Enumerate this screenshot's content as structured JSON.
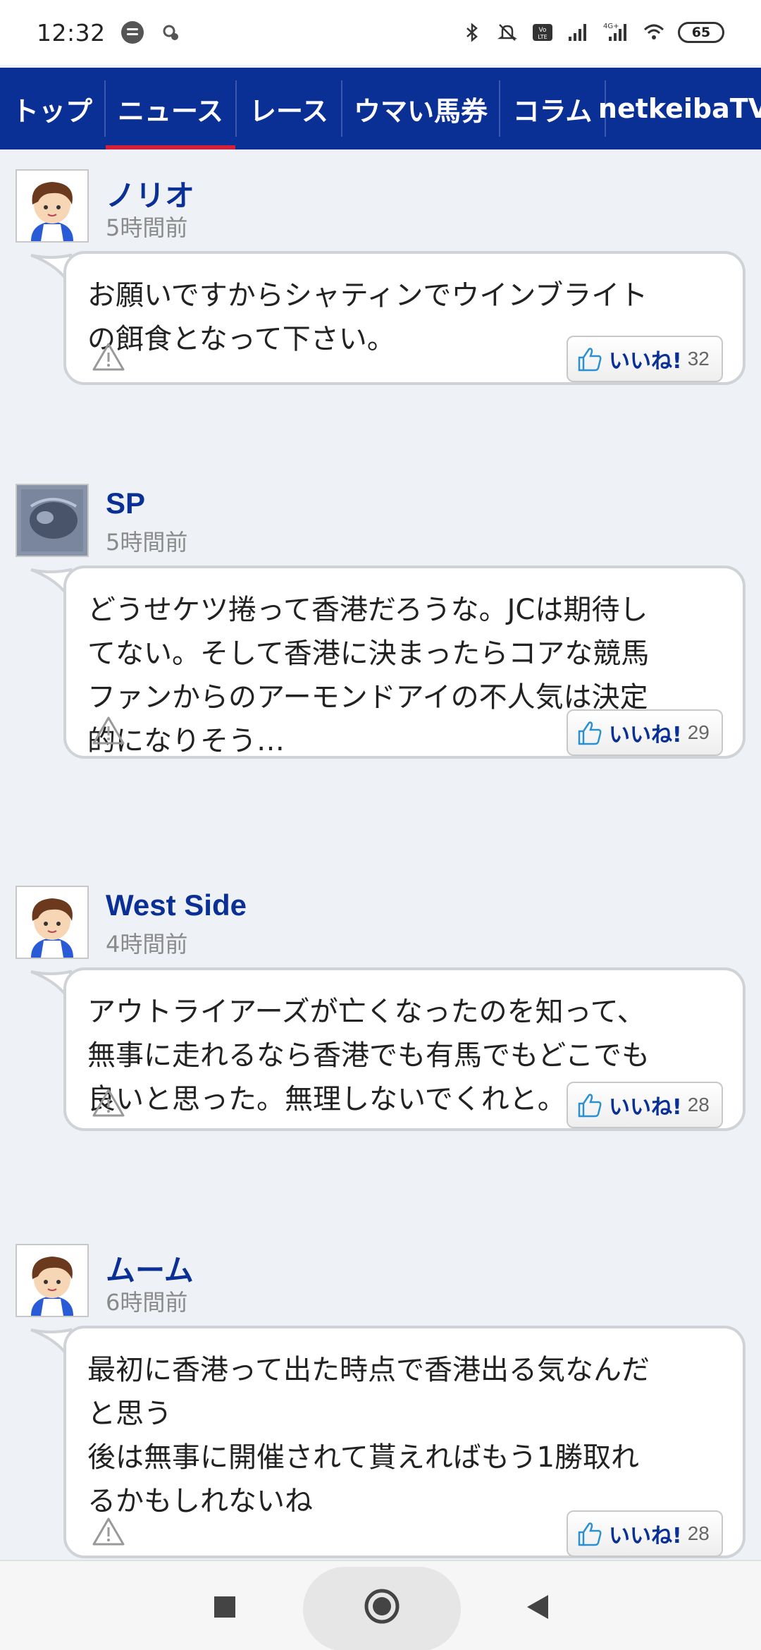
{
  "status_bar": {
    "time": "12:32",
    "battery": "65",
    "icons": [
      "spotify-icon",
      "recording-icon",
      "bluetooth-icon",
      "mute-icon",
      "volte-icon",
      "signal-icon",
      "4g-signal-icon",
      "wifi-icon",
      "battery-icon"
    ]
  },
  "nav": {
    "tabs": [
      {
        "label": "トップ"
      },
      {
        "label": "ニュース"
      },
      {
        "label": "レース"
      },
      {
        "label": "ウマい馬券"
      },
      {
        "label": "コラム"
      },
      {
        "label": "netkeibaTV"
      }
    ],
    "active_tab": "ニュース",
    "accent_color": "#0a2f95",
    "active_indicator_color": "#d3203a"
  },
  "comments": [
    {
      "user": "ノリオ",
      "time": "5時間前",
      "text": "お願いですからシャティンでウインブライト\nの餌食となって下さい。",
      "like_label": "いいね!",
      "likes": "32",
      "avatar": "default-boy-avatar"
    },
    {
      "user": "SP",
      "time": "5時間前",
      "text": "どうせケツ捲って香港だろうな。JCは期待し\nてない。そして香港に決まったらコアな競馬\nファンからのアーモンドアイの不人気は決定\n的になりそう…",
      "like_label": "いいね!",
      "likes": "29",
      "avatar": "photo-avatar"
    },
    {
      "user": "West Side",
      "time": "4時間前",
      "text": "アウトライアーズが亡くなったのを知って、\n無事に走れるなら香港でも有馬でもどこでも\n良いと思った。無理しないでくれと。",
      "like_label": "いいね!",
      "likes": "28",
      "avatar": "default-boy-avatar"
    },
    {
      "user": "ムーム",
      "time": "6時間前",
      "text": "最初に香港って出た時点で香港出る気なんだ\nと思う\n後は無事に開催されて貰えればもう1勝取れ\nるかもしれないね",
      "like_label": "いいね!",
      "likes": "28",
      "avatar": "default-boy-avatar"
    }
  ],
  "system_nav": {
    "buttons": [
      "recents-button",
      "home-button",
      "back-button"
    ]
  }
}
